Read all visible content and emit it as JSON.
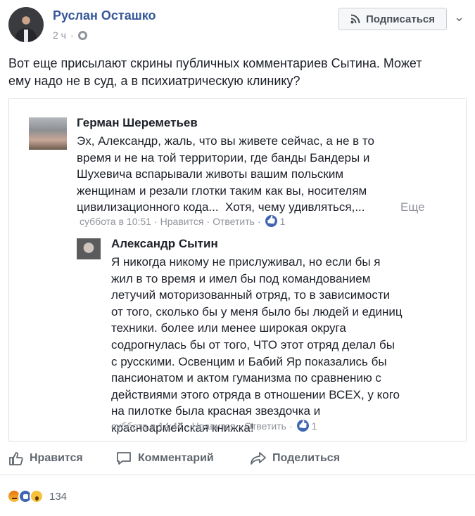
{
  "post": {
    "author": "Руслан Осташко",
    "time": "2 ч",
    "subscribe_label": "Подписаться",
    "more_label": "⌄",
    "text_line1": "Вот еще присылают скрины публичных комментариев Сытина. Может",
    "text_line2": "ему надо не в суд, а в психиатрическую клинику?"
  },
  "screenshot": {
    "comment1": {
      "author": "Герман Шереметьев",
      "text": "Эх, Александр, жаль, что вы живете сейчас, а не в то\nвремя и не на той территории, где банды Бандеры и\nШухевича вспарывали животы вашим польским\nженщинам и резали глотки таким как вы, носителям\nцивилизационного кода...  Хотя, чему удивляться,...",
      "more": "Еще",
      "time": "суббота в 10:51",
      "like": "Нравится",
      "reply": "Ответить",
      "dot": "·",
      "likes": "1"
    },
    "comment2": {
      "author": "Александр Сытин",
      "text": "Я никогда никому не прислуживал, но если бы я\nжил в то время и имел бы под командованием\nлетучий моторизованный отряд, то в зависимости\nот того, сколько бы у меня было бы людей и единиц\nтехники. более или менее широкая округа\nсодрогнулась бы от того, ЧТО этот отряд делал бы\nс русскими. Освенцим и Бабий Яр показались бы\nпансионатом и актом гуманизма по сравнению с\nдействиями этого отряда в отношении ВСЕХ, у кого\nна пилотке была красная звездочка и\nкрасноармейская книжка!",
      "time": "суббота в 14:44",
      "like": "Нравится",
      "reply": "Ответить",
      "dot": "·",
      "likes": "1"
    }
  },
  "actions": {
    "like": "Нравится",
    "comment": "Комментарий",
    "share": "Поделиться"
  },
  "reactions": {
    "count": "134"
  },
  "colors": {
    "link_blue": "#365899",
    "fb_blue": "#4267b2",
    "muted": "#90949c",
    "action_grey": "#606770"
  }
}
